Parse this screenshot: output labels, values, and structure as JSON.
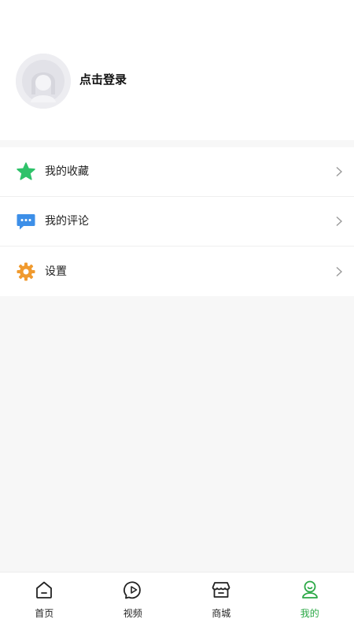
{
  "profile": {
    "login_prompt": "点击登录",
    "avatar_icon": "default-avatar-icon"
  },
  "menu": {
    "items": [
      {
        "label": "我的收藏",
        "icon": "star-icon",
        "icon_color": "#2fc26a"
      },
      {
        "label": "我的评论",
        "icon": "comment-icon",
        "icon_color": "#3d8fe8"
      },
      {
        "label": "设置",
        "icon": "gear-icon",
        "icon_color": "#f09a2e"
      }
    ]
  },
  "tabbar": {
    "active_color": "#2aa845",
    "tabs": [
      {
        "label": "首页",
        "icon": "home-icon",
        "active": false
      },
      {
        "label": "视频",
        "icon": "video-play-icon",
        "active": false
      },
      {
        "label": "商城",
        "icon": "shop-icon",
        "active": false
      },
      {
        "label": "我的",
        "icon": "profile-icon",
        "active": true
      }
    ]
  }
}
